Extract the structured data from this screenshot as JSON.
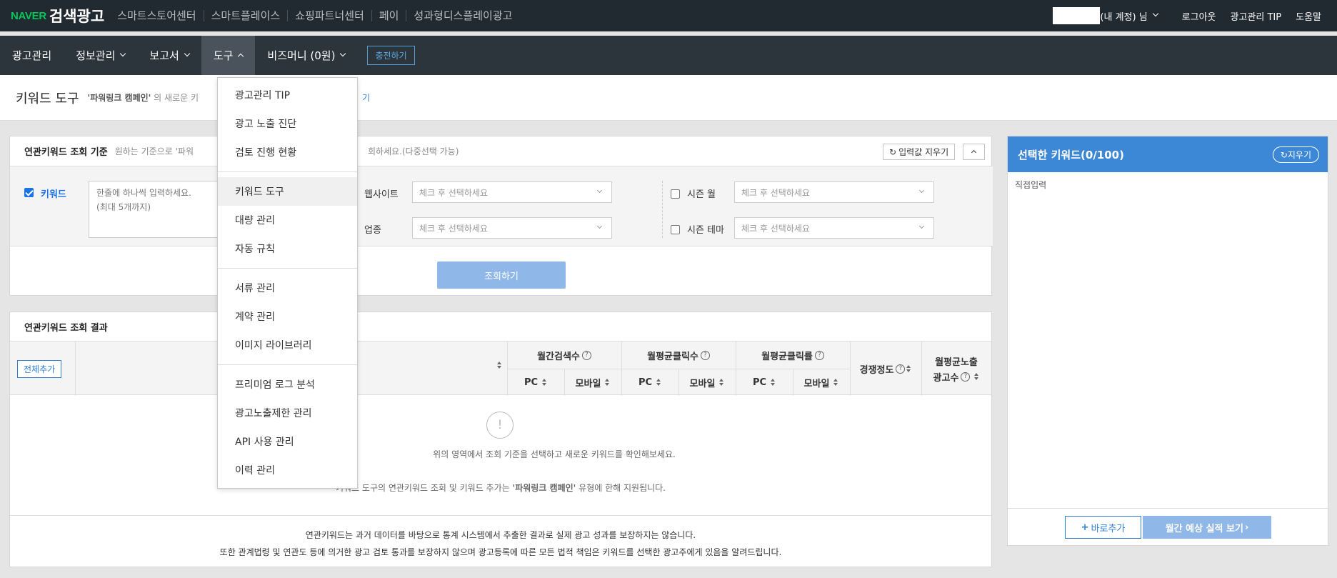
{
  "topbar": {
    "brand": "NAVER",
    "product": "검색광고",
    "links": [
      "스마트스토어센터",
      "스마트플레이스",
      "쇼핑파트너센터",
      "페이",
      "성과형디스플레이광고"
    ],
    "account_suffix": "(내 계정) 님",
    "logout": "로그아웃",
    "tip": "광고관리 TIP",
    "help": "도움말"
  },
  "nav": {
    "items": [
      "광고관리",
      "정보관리",
      "보고서",
      "도구",
      "비즈머니 (0원)"
    ],
    "charge": "충전하기"
  },
  "dropdown": {
    "group1": [
      "광고관리 TIP",
      "광고 노출 진단",
      "검토 진행 현황"
    ],
    "group2": [
      "키워드 도구",
      "대량 관리",
      "자동 규칙"
    ],
    "group3": [
      "서류 관리",
      "계약 관리",
      "이미지 라이브러리"
    ],
    "group4": [
      "프리미엄 로그 분석",
      "광고노출제한 관리",
      "API 사용 관리",
      "이력 관리"
    ]
  },
  "header": {
    "title": "키워드 도구",
    "sub_prefix": "'파워링크 캠페인'",
    "sub_text": "의 새로운 키",
    "link_tail": "기"
  },
  "criteria": {
    "title": "연관키워드 조회 기준",
    "hint": "원하는 기준으로 '파워",
    "hint_tail": "회하세요.(다중선택 가능)",
    "clear_btn": "입력값 지우기",
    "keyword_label": "키워드",
    "keyword_placeholder_1": "한줄에 하나씩 입력하세요.",
    "keyword_placeholder_2": "(최대 5개까지)",
    "website_label": "웹사이트",
    "industry_label": "업종",
    "season_month_label": "시즌 월",
    "season_theme_label": "시즌 테마",
    "select_placeholder": "체크 후 선택하세요",
    "search_btn": "조회하기"
  },
  "results": {
    "title": "연관키워드 조회 결과",
    "add_all": "전체추가",
    "col_monthly_search": "월간검색수",
    "col_avg_clicks": "월평균클릭수",
    "col_avg_ctr": "월평균클릭률",
    "col_competition": "경쟁정도",
    "col_avg_ad_1": "월평균노출",
    "col_avg_ad_2": "광고수",
    "pc": "PC",
    "mobile": "모바일",
    "empty_icon": "!",
    "empty_msg": "위의 영역에서 조회 기준을 선택하고 새로운 키워드를 확인해보세요.",
    "note_prefix": "키워드 도구의 연관키워드 조회 및 키워드 추가는",
    "note_campaign": "'파워링크 캠페인'",
    "note_suffix": "유형에 한해 지원됩니다.",
    "disclaimer_1": "연관키워드는 과거 데이터를 바탕으로 통계 시스템에서 추출한 결과로 실제 광고 성과를 보장하지는 않습니다.",
    "disclaimer_2": "또한 관계법령 및 연관도 등에 의거한 광고 검토 통과를 보장하지 않으며 광고등록에 따른 모든 법적 책임은 키워드를 선택한 광고주에게 있음을 알려드립니다."
  },
  "selected": {
    "title": "선택한 키워드(0/100)",
    "clear": "지우기",
    "direct_input": "직접입력",
    "add_btn": "바로추가",
    "estimate_btn": "월간 예상 실적 보기"
  },
  "colors": {
    "topbar": "#222a31",
    "navbar": "#2d353c",
    "accent": "#3c87d6",
    "brand": "#03c75a"
  }
}
